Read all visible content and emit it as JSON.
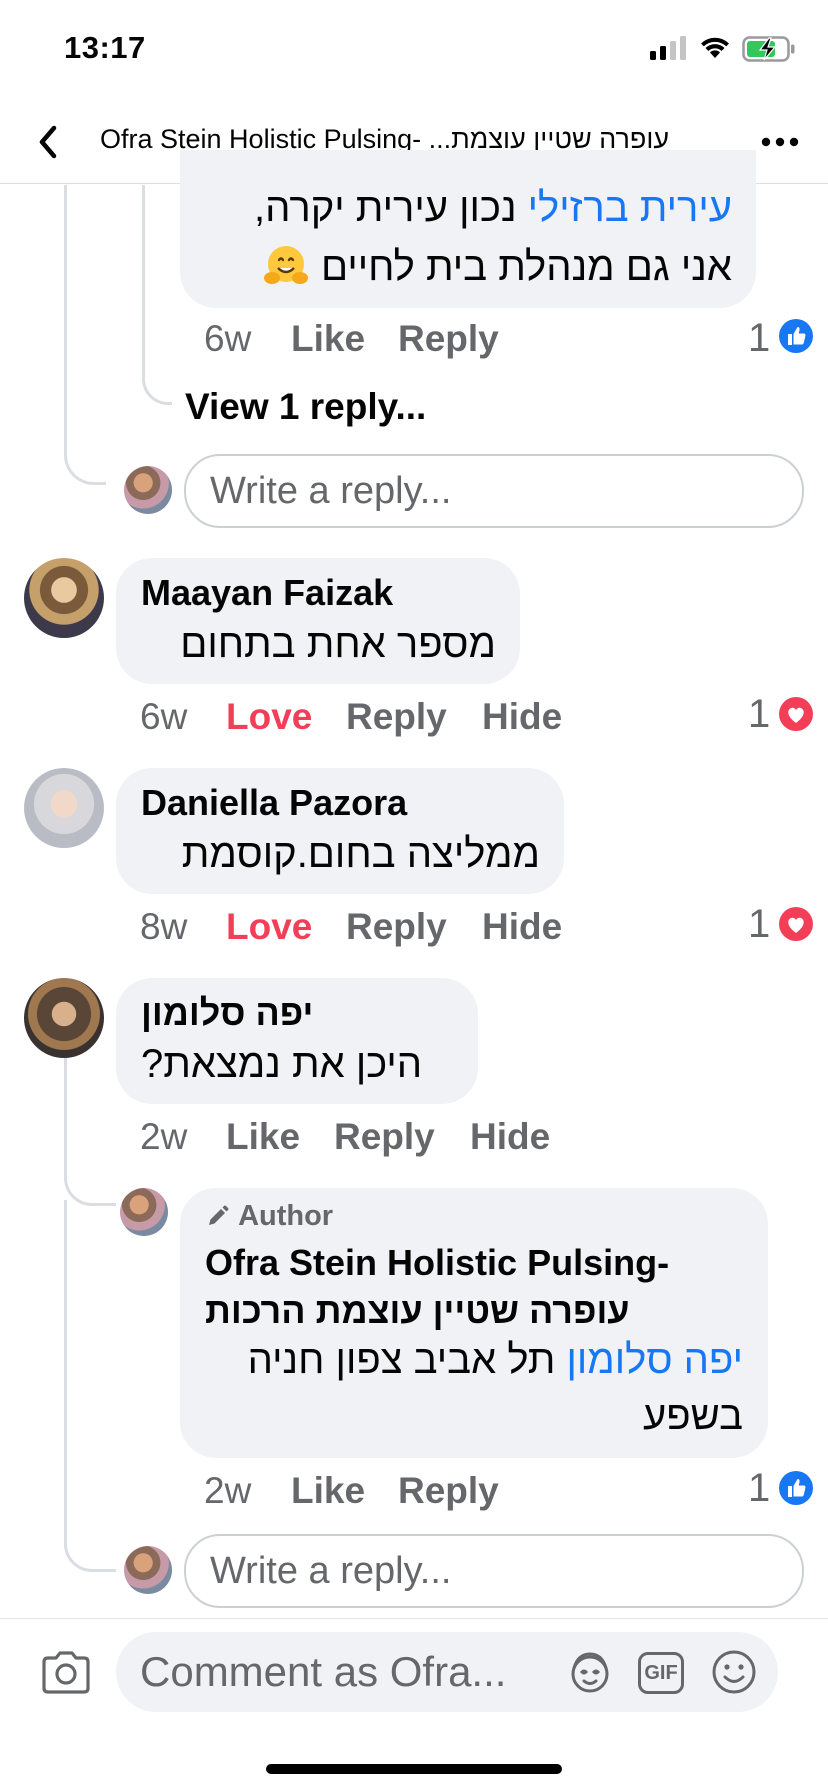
{
  "status_bar": {
    "time": "13:17"
  },
  "header": {
    "title": "Ofra Stein Holistic Pulsing- עופרה שטיין עוצמת...",
    "title_ltr": "Ofra Stein Holistic Pulsing-",
    "title_rtl": "עופרה שטיין עוצמת..."
  },
  "comments": [
    {
      "kind": "reply",
      "mention": "עירית ברזילי",
      "text_line1": " נכון עירית יקרה,",
      "text_line2": "אני גם מנהלת בית לחיים",
      "emoji": "hugging-face",
      "time": "6w",
      "like": "Like",
      "reply": "Reply",
      "reaction_count": "1",
      "reaction": "like"
    },
    {
      "kind": "comment",
      "name": "Maayan Faizak",
      "text": "מספר אחת בתחום",
      "time": "6w",
      "like": "Love",
      "reply": "Reply",
      "hide": "Hide",
      "reaction_count": "1",
      "reaction": "love"
    },
    {
      "kind": "comment",
      "name": "Daniella Pazora",
      "text": "ממליצה בחום.קוסמת",
      "time": "8w",
      "like": "Love",
      "reply": "Reply",
      "hide": "Hide",
      "reaction_count": "1",
      "reaction": "love"
    },
    {
      "kind": "comment",
      "name": "יפה סלומון",
      "text": "היכן את נמצאת?",
      "time": "2w",
      "like": "Like",
      "reply": "Reply",
      "hide": "Hide"
    },
    {
      "kind": "reply",
      "author_badge": "Author",
      "name_line1": "Ofra Stein Holistic Pulsing-",
      "name_line2": "עופרה שטיין עוצמת הרכות",
      "mention": "יפה סלומון",
      "text_line1": " תל אביב צפון חניה",
      "text_line2": "בשפע",
      "time": "2w",
      "like": "Like",
      "reply": "Reply",
      "reaction_count": "1",
      "reaction": "like"
    }
  ],
  "view_replies": "View 1 reply...",
  "reply_placeholder": "Write a reply...",
  "composer": {
    "placeholder": "Comment as Ofra...",
    "gif_label": "GIF"
  },
  "colors": {
    "accent": "#1877f2",
    "love": "#f33e58",
    "bubble": "#f0f2f5",
    "meta": "#65676b"
  }
}
